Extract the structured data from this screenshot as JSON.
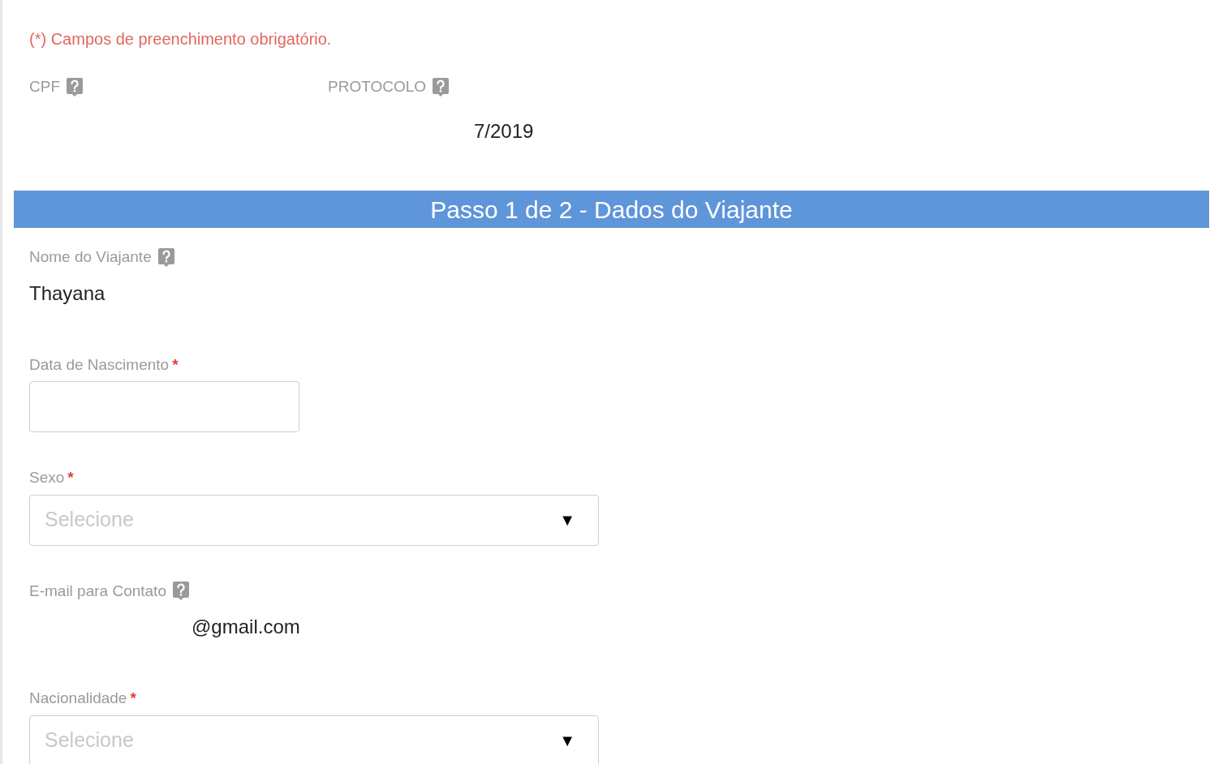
{
  "required_note": "(*) Campos de preenchimento obrigatório.",
  "top_fields": [
    {
      "label": "CPF",
      "help": true
    },
    {
      "label": "PROTOCOLO",
      "help": true,
      "value": "7/2019"
    }
  ],
  "step_banner": "Passo 1 de 2 - Dados do Viajante",
  "fields": [
    {
      "kind": "readonly",
      "label": "Nome do Viajante",
      "help": true,
      "value": "Thayana"
    },
    {
      "kind": "text",
      "label": "Data de Nascimento",
      "help": false,
      "required_mark": "*"
    },
    {
      "kind": "select",
      "label": "Sexo",
      "help": false,
      "required_mark": "*",
      "placeholder": "Selecione",
      "caret": "▼"
    },
    {
      "kind": "readonly",
      "label": "E-mail para Contato",
      "help": true,
      "value": "@gmail.com"
    },
    {
      "kind": "select",
      "label": "Nacionalidade",
      "help": false,
      "required_mark": "*",
      "placeholder": "Selecione",
      "caret": "▼"
    }
  ]
}
